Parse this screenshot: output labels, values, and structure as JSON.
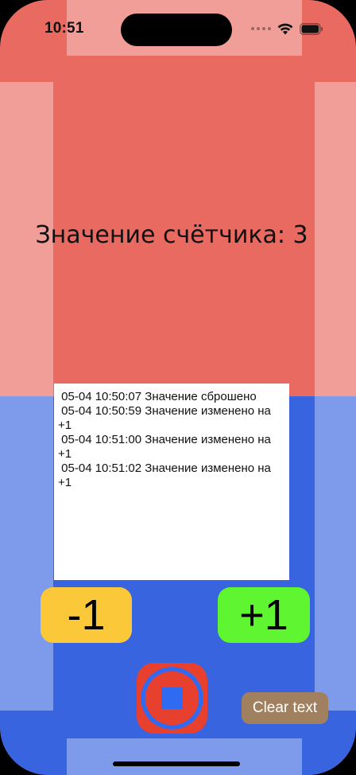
{
  "status_bar": {
    "time": "10:51"
  },
  "counter": {
    "label": "Значение счётчика: 3"
  },
  "log": {
    "lines": [
      " 05-04 10:50:07 Значение сброшено",
      " 05-04 10:50:59 Значение изменено на +1",
      " 05-04 10:51:00 Значение изменено на +1",
      " 05-04 10:51:02 Значение изменено на +1"
    ]
  },
  "buttons": {
    "decrement_label": "-1",
    "increment_label": "+1",
    "clear_label": "Clear text"
  },
  "colors": {
    "top_background": "#e96a60",
    "bottom_background": "#3864e0",
    "decrement": "#fbc83a",
    "increment": "#5ff530",
    "record": "#e8402f",
    "record_inner": "#2f6bf2",
    "clear": "#a0805e"
  },
  "icons": {
    "record": "stop-record-icon",
    "wifi": "wifi-icon",
    "battery": "battery-icon",
    "signal": "cellular-signal-icon"
  }
}
